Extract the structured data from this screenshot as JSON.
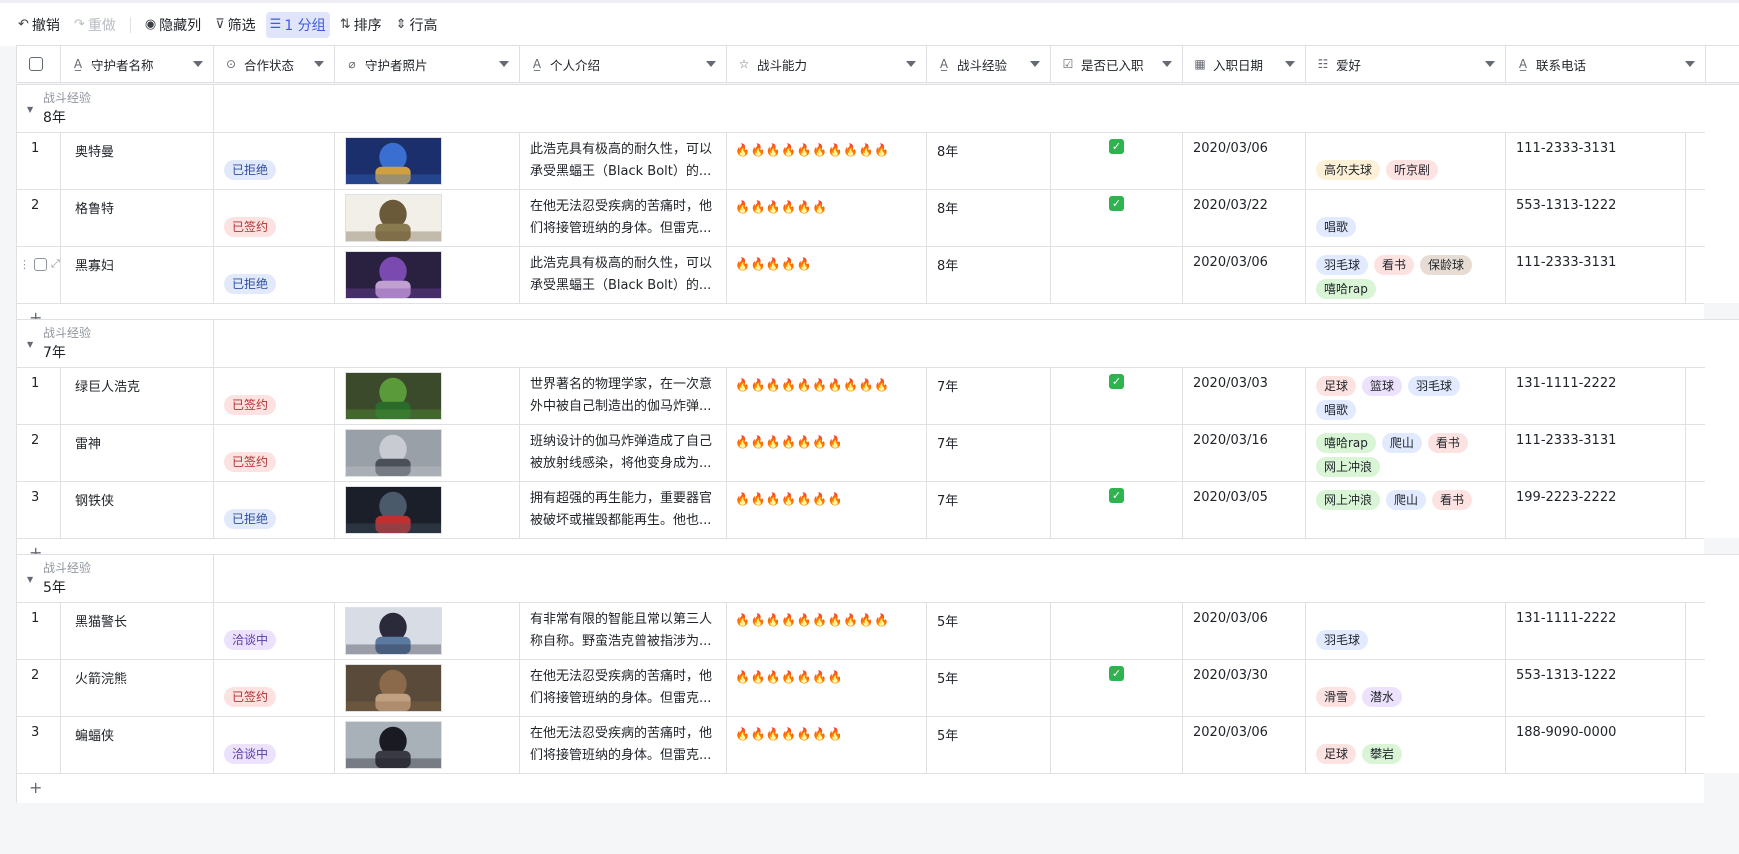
{
  "toolbar": {
    "undo": "撤销",
    "redo": "重做",
    "hide_cols": "隐藏列",
    "filter": "筛选",
    "group": "1 分组",
    "sort": "排序",
    "row_height": "行高"
  },
  "columns": [
    {
      "label": "守护者名称",
      "icon": "text-icon"
    },
    {
      "label": "合作状态",
      "icon": "single-select-icon"
    },
    {
      "label": "守护者照片",
      "icon": "attachment-icon"
    },
    {
      "label": "个人介绍",
      "icon": "text-icon"
    },
    {
      "label": "战斗能力",
      "icon": "star-icon"
    },
    {
      "label": "战斗经验",
      "icon": "text-icon"
    },
    {
      "label": "是否已入职",
      "icon": "checkbox-icon"
    },
    {
      "label": "入职日期",
      "icon": "date-icon"
    },
    {
      "label": "爱好",
      "icon": "multi-select-icon"
    },
    {
      "label": "联系电话",
      "icon": "text-icon"
    }
  ],
  "groups": [
    {
      "field": "战斗经验",
      "value": "8年",
      "rows": [
        {
          "no": "1",
          "name": "奥特曼",
          "status": "已拒绝",
          "status_type": "reject",
          "photo": "blue",
          "intro": "此浩克具有极高的耐久性，可以承受黑蝠王（Black Bolt）的...",
          "fire": "🔥🔥🔥🔥🔥🔥🔥🔥🔥🔥",
          "exp": "8年",
          "joined": true,
          "date": "2020/03/06",
          "hobbies": [
            [
              "高尔夫球",
              "yellow"
            ],
            [
              "听京剧",
              "pink"
            ]
          ],
          "phone": "111-2333-3131"
        },
        {
          "no": "2",
          "name": "格鲁特",
          "status": "已签约",
          "status_type": "signed",
          "photo": "tree",
          "intro": "在他无法忍受疾病的苦痛时，他们将接管班纳的身体。但雷克...",
          "fire": "🔥🔥🔥🔥🔥🔥",
          "exp": "8年",
          "joined": true,
          "date": "2020/03/22",
          "hobbies": [
            [
              "唱歌",
              "blue"
            ]
          ],
          "phone": "553-1313-1222"
        },
        {
          "no": "",
          "name": "黑寡妇",
          "status": "已拒绝",
          "status_type": "reject",
          "photo": "purple",
          "intro": "此浩克具有极高的耐久性，可以承受黑蝠王（Black Bolt）的...",
          "fire": "🔥🔥🔥🔥🔥",
          "exp": "8年",
          "joined": false,
          "date": "2020/03/06",
          "hobbies": [
            [
              "羽毛球",
              "blue"
            ],
            [
              "看书",
              "pink"
            ],
            [
              "保龄球",
              "brown"
            ],
            [
              "嘻哈rap",
              "green"
            ]
          ],
          "phone": "111-2333-3131"
        }
      ]
    },
    {
      "field": "战斗经验",
      "value": "7年",
      "rows": [
        {
          "no": "1",
          "name": "绿巨人浩克",
          "status": "已签约",
          "status_type": "signed",
          "photo": "green",
          "intro": "世界著名的物理学家，在一次意外中被自己制造出的伽马炸弹...",
          "fire": "🔥🔥🔥🔥🔥🔥🔥🔥🔥🔥",
          "exp": "7年",
          "joined": true,
          "date": "2020/03/03",
          "hobbies": [
            [
              "足球",
              "pink"
            ],
            [
              "篮球",
              "purple"
            ],
            [
              "羽毛球",
              "blue"
            ],
            [
              "唱歌",
              "blue"
            ]
          ],
          "phone": "131-1111-2222"
        },
        {
          "no": "2",
          "name": "雷神",
          "status": "已签约",
          "status_type": "signed",
          "photo": "grey",
          "intro": "班纳设计的伽马炸弹造成了自己被放射线感染，将他变身成为...",
          "fire": "🔥🔥🔥🔥🔥🔥🔥",
          "exp": "7年",
          "joined": false,
          "date": "2020/03/16",
          "hobbies": [
            [
              "嘻哈rap",
              "green"
            ],
            [
              "爬山",
              "blue"
            ],
            [
              "看书",
              "pink"
            ],
            [
              "网上冲浪",
              "green"
            ]
          ],
          "phone": "111-2333-3131"
        },
        {
          "no": "3",
          "name": "钢铁侠",
          "status": "已拒绝",
          "status_type": "reject",
          "photo": "dark",
          "intro": "拥有超强的再生能力，重要器官被破坏或摧毁都能再生。他也...",
          "fire": "🔥🔥🔥🔥🔥🔥🔥",
          "exp": "7年",
          "joined": true,
          "date": "2020/03/05",
          "hobbies": [
            [
              "网上冲浪",
              "green"
            ],
            [
              "爬山",
              "blue"
            ],
            [
              "看书",
              "pink"
            ]
          ],
          "phone": "199-2223-2222"
        }
      ]
    },
    {
      "field": "战斗经验",
      "value": "5年",
      "rows": [
        {
          "no": "1",
          "name": "黑猫警长",
          "status": "洽谈中",
          "status_type": "talk",
          "photo": "light",
          "intro": "有非常有限的智能且常以第三人称自称。野蛮浩克曾被指涉为...",
          "fire": "🔥🔥🔥🔥🔥🔥🔥🔥🔥🔥",
          "exp": "5年",
          "joined": false,
          "date": "2020/03/06",
          "hobbies": [
            [
              "羽毛球",
              "blue"
            ]
          ],
          "phone": "131-1111-2222"
        },
        {
          "no": "2",
          "name": "火箭浣熊",
          "status": "已签约",
          "status_type": "signed",
          "photo": "brown",
          "intro": "在他无法忍受疾病的苦痛时，他们将接管班纳的身体。但雷克...",
          "fire": "🔥🔥🔥🔥🔥🔥🔥",
          "exp": "5年",
          "joined": true,
          "date": "2020/03/30",
          "hobbies": [
            [
              "滑雪",
              "pink"
            ],
            [
              "潜水",
              "purple"
            ]
          ],
          "phone": "553-1313-1222"
        },
        {
          "no": "3",
          "name": "蝙蝠侠",
          "status": "洽谈中",
          "status_type": "talk",
          "photo": "bat",
          "intro": "在他无法忍受疾病的苦痛时，他们将接管班纳的身体。但雷克...",
          "fire": "🔥🔥🔥🔥🔥🔥🔥",
          "exp": "5年",
          "joined": false,
          "date": "2020/03/06",
          "hobbies": [
            [
              "足球",
              "pink"
            ],
            [
              "攀岩",
              "green"
            ]
          ],
          "phone": "188-9090-0000"
        }
      ]
    }
  ]
}
